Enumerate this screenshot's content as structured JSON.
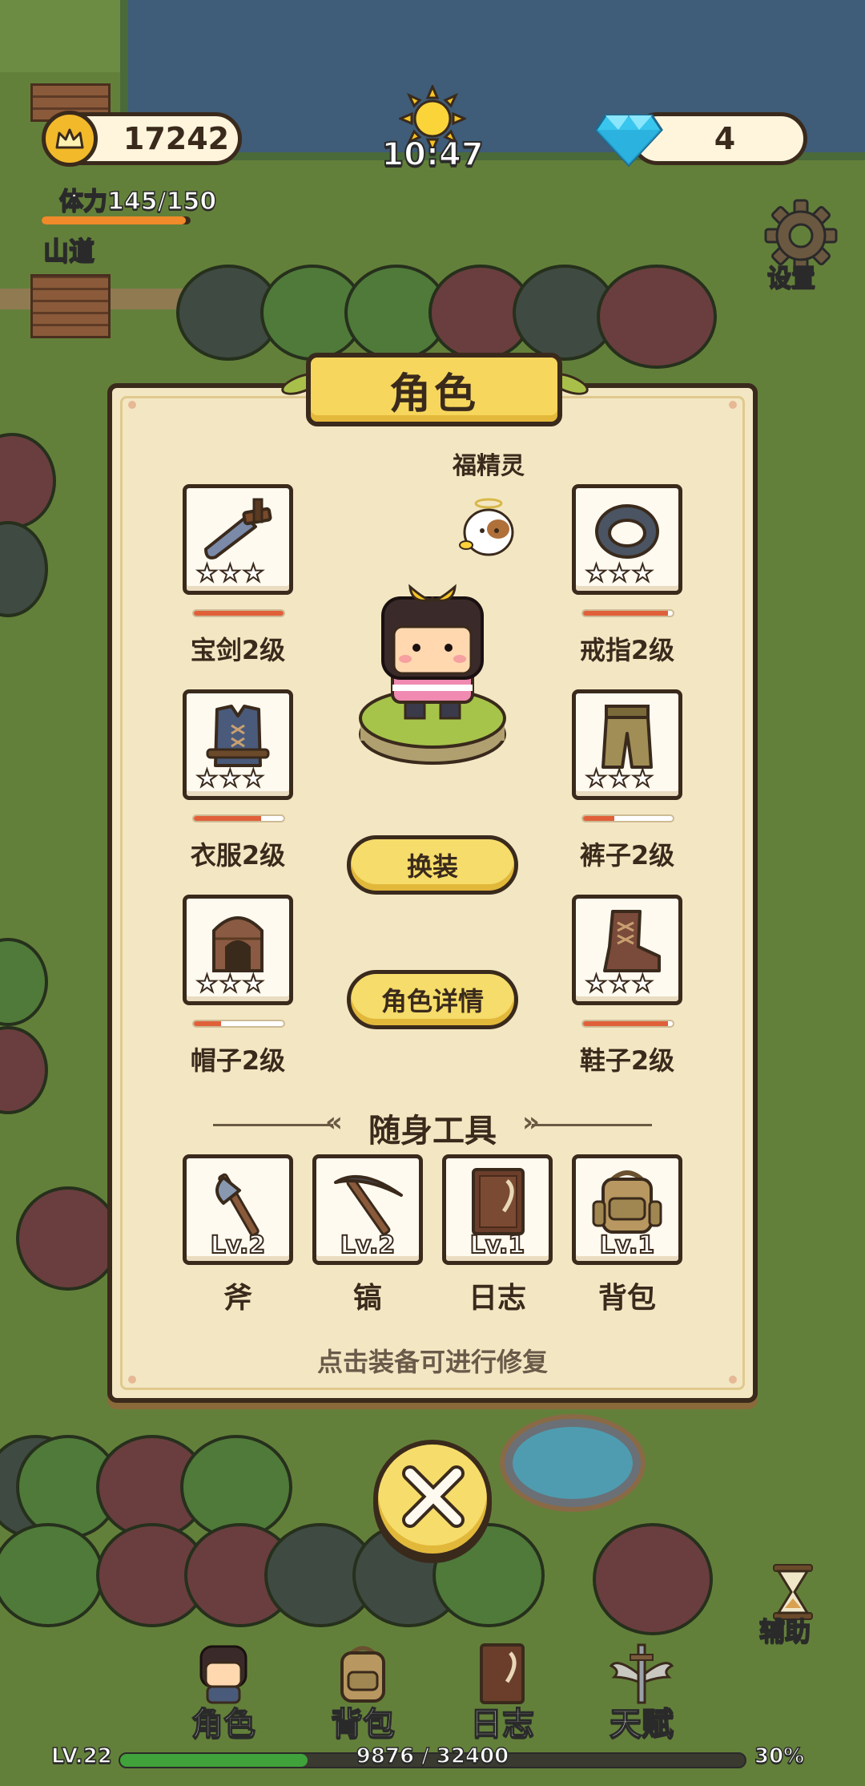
{
  "hud": {
    "coins": "17242",
    "time": "10:47",
    "gems": "4",
    "stamina": "体力145/150",
    "stamina_fraction": 0.967,
    "location": "山道",
    "settings_label": "设置"
  },
  "panel": {
    "title": "角色",
    "pet_name": "福精灵",
    "equipment": [
      {
        "label": "宝剑2级",
        "icon": "sword-icon",
        "stars": 3,
        "durability": 1.0
      },
      {
        "label": "戒指2级",
        "icon": "ring-icon",
        "stars": 3,
        "durability": 0.95
      },
      {
        "label": "衣服2级",
        "icon": "shirt-icon",
        "stars": 3,
        "durability": 0.75
      },
      {
        "label": "裤子2级",
        "icon": "pants-icon",
        "stars": 3,
        "durability": 0.35
      },
      {
        "label": "帽子2级",
        "icon": "hat-icon",
        "stars": 3,
        "durability": 0.3
      },
      {
        "label": "鞋子2级",
        "icon": "boots-icon",
        "stars": 3,
        "durability": 0.95
      }
    ],
    "change_outfit_label": "换装",
    "character_detail_label": "角色详情",
    "tools_header": "随身工具",
    "tools": [
      {
        "name": "斧",
        "level": "Lv.2",
        "icon": "axe-icon"
      },
      {
        "name": "镐",
        "level": "Lv.2",
        "icon": "pickaxe-icon"
      },
      {
        "name": "日志",
        "level": "Lv.1",
        "icon": "journal-icon"
      },
      {
        "name": "背包",
        "level": "Lv.1",
        "icon": "backpack-icon"
      }
    ],
    "hint": "点击装备可进行修复"
  },
  "nav": {
    "items": [
      {
        "label": "角色",
        "icon": "character-icon"
      },
      {
        "label": "背包",
        "icon": "backpack-icon"
      },
      {
        "label": "日志",
        "icon": "journal-icon"
      },
      {
        "label": "天赋",
        "icon": "wings-sword-icon"
      }
    ],
    "assist_label": "辅助"
  },
  "xp": {
    "level": "LV.22",
    "progress": "9876 / 32400",
    "percent": "30%",
    "fraction": 0.3
  },
  "colors": {
    "grass": "#63803a",
    "water": "#3f5c78",
    "panel": "#f3e7c3",
    "button": "#f6dc6a",
    "outline": "#3a2a1c",
    "durability": "#e0603a",
    "xp": "#3fa23a"
  }
}
